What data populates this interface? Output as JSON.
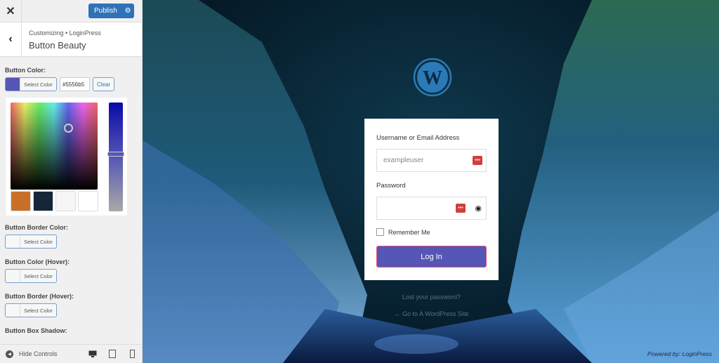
{
  "sidebar": {
    "close_label": "✕",
    "publish_label": "Publish",
    "breadcrumb": "Customizing • LoginPress",
    "title": "Button Beauty",
    "button_color": {
      "label": "Button Color:",
      "select_label": "Select Color",
      "value": "#5556b5",
      "clear_label": "Clear"
    },
    "palette": [
      "#c8702a",
      "#15263a",
      "#f6f6f6",
      "#ffffff"
    ],
    "controls": [
      {
        "label": "Button Border Color:",
        "select_label": "Select Color"
      },
      {
        "label": "Button Color (Hover):",
        "select_label": "Select Color"
      },
      {
        "label": "Button Border (Hover):",
        "select_label": "Select Color"
      },
      {
        "label": "Button Box Shadow:"
      }
    ],
    "footer": {
      "hide_controls": "Hide Controls"
    }
  },
  "login": {
    "username_label": "Username or Email Address",
    "username_value": "exampleuser",
    "password_label": "Password",
    "remember_label": "Remember Me",
    "login_label": "Log In",
    "lost_password": "Lost your password?",
    "back_link": "← Go to A WordPress Site",
    "powered_by": "Powered by: LoginPress"
  },
  "colors": {
    "accent": "#5556b5",
    "publish": "#2f72b8",
    "lastpass": "#d0403c"
  }
}
